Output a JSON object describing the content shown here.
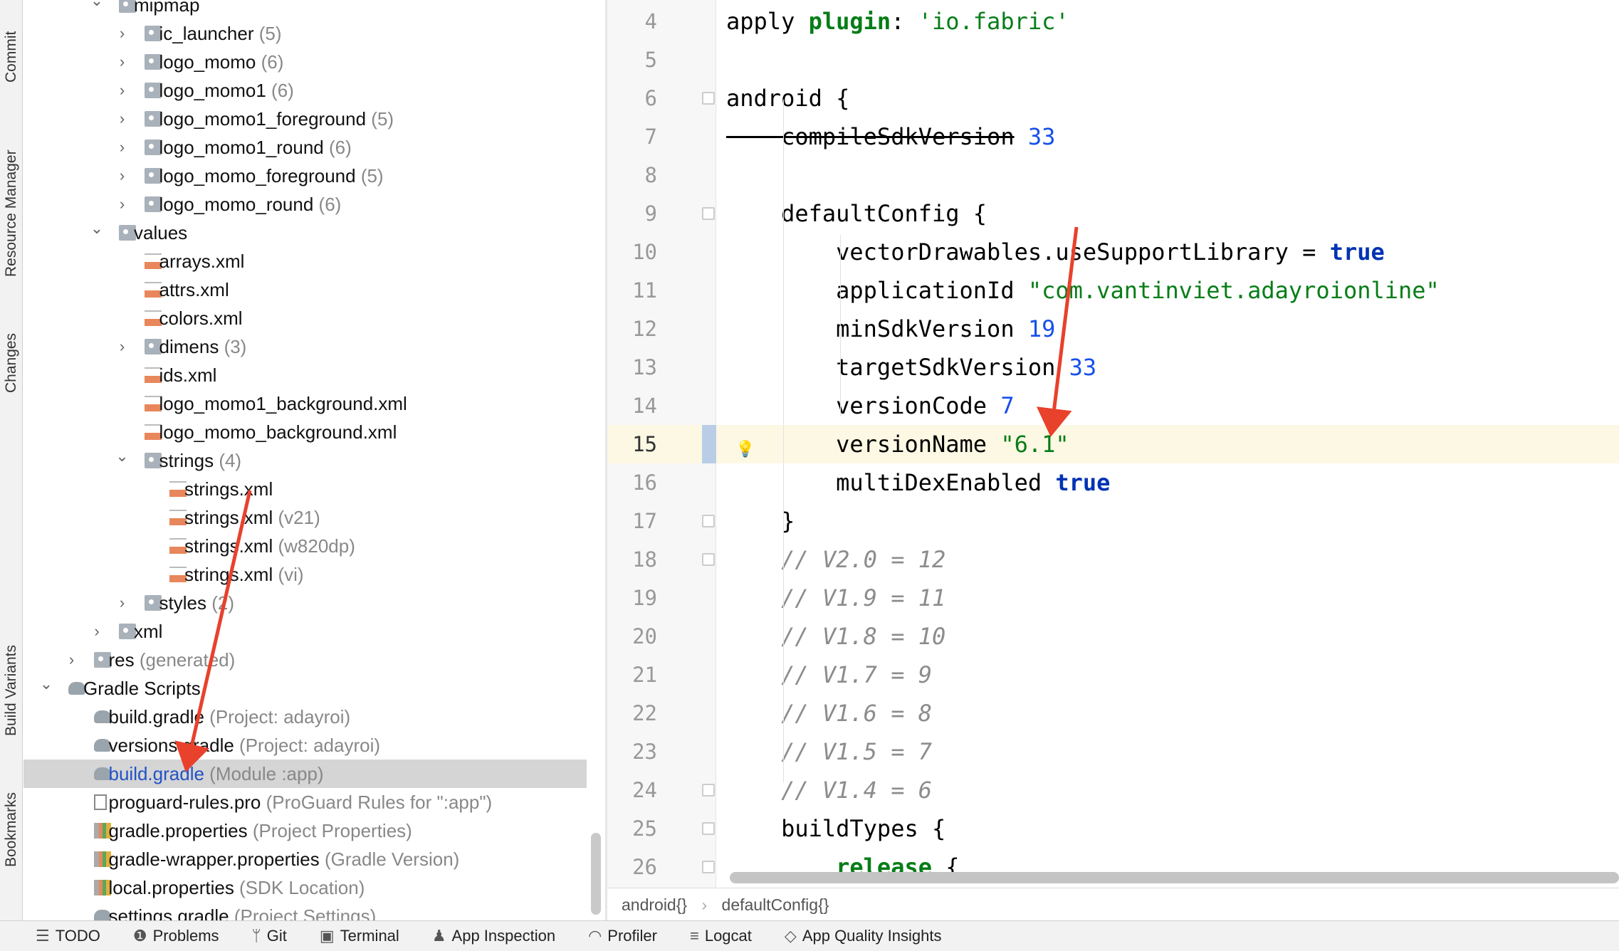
{
  "left_strip": [
    "Commit",
    "Resource Manager",
    "Changes",
    "Build Variants",
    "Bookmarks"
  ],
  "tree": [
    {
      "level": 2,
      "chev": "open",
      "icon": "folder",
      "name": "mipmap",
      "hint": ""
    },
    {
      "level": 3,
      "chev": "closed",
      "icon": "folder",
      "name": "ic_launcher",
      "hint": "(5)"
    },
    {
      "level": 3,
      "chev": "closed",
      "icon": "folder",
      "name": "logo_momo",
      "hint": "(6)"
    },
    {
      "level": 3,
      "chev": "closed",
      "icon": "folder",
      "name": "logo_momo1",
      "hint": "(6)"
    },
    {
      "level": 3,
      "chev": "closed",
      "icon": "folder",
      "name": "logo_momo1_foreground",
      "hint": "(5)"
    },
    {
      "level": 3,
      "chev": "closed",
      "icon": "folder",
      "name": "logo_momo1_round",
      "hint": "(6)"
    },
    {
      "level": 3,
      "chev": "closed",
      "icon": "folder",
      "name": "logo_momo_foreground",
      "hint": "(5)"
    },
    {
      "level": 3,
      "chev": "closed",
      "icon": "folder",
      "name": "logo_momo_round",
      "hint": "(6)"
    },
    {
      "level": 2,
      "chev": "open",
      "icon": "folder",
      "name": "values",
      "hint": ""
    },
    {
      "level": 3,
      "chev": "",
      "icon": "xml",
      "name": "arrays.xml",
      "hint": ""
    },
    {
      "level": 3,
      "chev": "",
      "icon": "xml",
      "name": "attrs.xml",
      "hint": ""
    },
    {
      "level": 3,
      "chev": "",
      "icon": "xml",
      "name": "colors.xml",
      "hint": ""
    },
    {
      "level": 3,
      "chev": "closed",
      "icon": "folder",
      "name": "dimens",
      "hint": "(3)"
    },
    {
      "level": 3,
      "chev": "",
      "icon": "xml",
      "name": "ids.xml",
      "hint": ""
    },
    {
      "level": 3,
      "chev": "",
      "icon": "xml",
      "name": "logo_momo1_background.xml",
      "hint": ""
    },
    {
      "level": 3,
      "chev": "",
      "icon": "xml",
      "name": "logo_momo_background.xml",
      "hint": ""
    },
    {
      "level": 3,
      "chev": "open",
      "icon": "folder",
      "name": "strings",
      "hint": "(4)"
    },
    {
      "level": 4,
      "chev": "",
      "icon": "xml",
      "name": "strings.xml",
      "hint": ""
    },
    {
      "level": 4,
      "chev": "",
      "icon": "xml",
      "name": "strings.xml",
      "hint": "(v21)"
    },
    {
      "level": 4,
      "chev": "",
      "icon": "xml",
      "name": "strings.xml",
      "hint": "(w820dp)"
    },
    {
      "level": 4,
      "chev": "",
      "icon": "xml",
      "name": "strings.xml",
      "hint": "(vi)"
    },
    {
      "level": 3,
      "chev": "closed",
      "icon": "folder",
      "name": "styles",
      "hint": "(2)"
    },
    {
      "level": 2,
      "chev": "closed",
      "icon": "folder",
      "name": "xml",
      "hint": ""
    },
    {
      "level": 1,
      "chev": "closed",
      "icon": "folder",
      "name": "res",
      "hint": "(generated)"
    },
    {
      "level": 0,
      "chev": "open",
      "icon": "gradle",
      "name": "Gradle Scripts",
      "hint": ""
    },
    {
      "level": 1,
      "chev": "",
      "icon": "gradle",
      "name": "build.gradle",
      "hint": "(Project: adayroi)"
    },
    {
      "level": 1,
      "chev": "",
      "icon": "gradle",
      "name": "versions.gradle",
      "hint": "(Project: adayroi)"
    },
    {
      "level": 1,
      "chev": "",
      "icon": "gradle",
      "name": "build.gradle",
      "hint": "(Module :app)",
      "selected": true
    },
    {
      "level": 1,
      "chev": "",
      "icon": "file",
      "name": "proguard-rules.pro",
      "hint": "(ProGuard Rules for \":app\")"
    },
    {
      "level": 1,
      "chev": "",
      "icon": "props",
      "name": "gradle.properties",
      "hint": "(Project Properties)"
    },
    {
      "level": 1,
      "chev": "",
      "icon": "props",
      "name": "gradle-wrapper.properties",
      "hint": "(Gradle Version)"
    },
    {
      "level": 1,
      "chev": "",
      "icon": "props",
      "name": "local.properties",
      "hint": "(SDK Location)"
    },
    {
      "level": 1,
      "chev": "",
      "icon": "gradle",
      "name": "settings.gradle",
      "hint": "(Project Settings)"
    }
  ],
  "code": [
    {
      "n": "4",
      "t": [
        [
          "k",
          "apply "
        ],
        [
          "g",
          "plugin"
        ],
        [
          "k",
          ": "
        ],
        [
          "s",
          "'io.fabric'"
        ]
      ]
    },
    {
      "n": "5",
      "t": []
    },
    {
      "n": "6",
      "fold": true,
      "t": [
        [
          "k",
          "android {"
        ]
      ]
    },
    {
      "n": "7",
      "t": [
        [
          "k st",
          "    compileSdkVersion"
        ],
        [
          "k",
          " "
        ],
        [
          "n",
          "33"
        ]
      ]
    },
    {
      "n": "8",
      "t": []
    },
    {
      "n": "9",
      "fold": true,
      "t": [
        [
          "k",
          "    defaultConfig {"
        ]
      ]
    },
    {
      "n": "10",
      "t": [
        [
          "k",
          "        vectorDrawables.useSupportLibrary = "
        ],
        [
          "b",
          "true"
        ]
      ]
    },
    {
      "n": "11",
      "t": [
        [
          "k",
          "        applicationId "
        ],
        [
          "s",
          "\"com.vantinviet.adayroionline\""
        ]
      ]
    },
    {
      "n": "12",
      "t": [
        [
          "k",
          "        minSdkVersion "
        ],
        [
          "n",
          "19"
        ]
      ]
    },
    {
      "n": "13",
      "t": [
        [
          "k",
          "        targetSdkVersion "
        ],
        [
          "n",
          "33"
        ]
      ]
    },
    {
      "n": "14",
      "t": [
        [
          "k",
          "        versionCode "
        ],
        [
          "n",
          "7"
        ]
      ]
    },
    {
      "n": "15",
      "hl": true,
      "t": [
        [
          "k",
          "        versionName "
        ],
        [
          "s",
          "\"6.1\""
        ]
      ]
    },
    {
      "n": "16",
      "t": [
        [
          "k",
          "        multiDexEnabled "
        ],
        [
          "b",
          "true"
        ]
      ]
    },
    {
      "n": "17",
      "fold": true,
      "t": [
        [
          "k",
          "    }"
        ]
      ]
    },
    {
      "n": "18",
      "fold": true,
      "t": [
        [
          "c",
          "    // V2.0 = 12"
        ]
      ]
    },
    {
      "n": "19",
      "t": [
        [
          "c",
          "    // V1.9 = 11"
        ]
      ]
    },
    {
      "n": "20",
      "t": [
        [
          "c",
          "    // V1.8 = 10"
        ]
      ]
    },
    {
      "n": "21",
      "t": [
        [
          "c",
          "    // V1.7 = 9"
        ]
      ]
    },
    {
      "n": "22",
      "t": [
        [
          "c",
          "    // V1.6 = 8"
        ]
      ]
    },
    {
      "n": "23",
      "t": [
        [
          "c",
          "    // V1.5 = 7"
        ]
      ]
    },
    {
      "n": "24",
      "fold": true,
      "t": [
        [
          "c",
          "    // V1.4 = 6"
        ]
      ]
    },
    {
      "n": "25",
      "fold": true,
      "t": [
        [
          "k",
          "    buildTypes {"
        ]
      ]
    },
    {
      "n": "26",
      "fold": true,
      "t": [
        [
          "g",
          "        release"
        ],
        [
          "k",
          " {"
        ]
      ]
    }
  ],
  "breadcrumb": [
    "android{}",
    "defaultConfig{}"
  ],
  "status_bar": [
    {
      "icon": "list-icon",
      "glyph": "☰",
      "label": "TODO"
    },
    {
      "icon": "problems-icon",
      "glyph": "❶",
      "label": "Problems"
    },
    {
      "icon": "git-branch-icon",
      "glyph": "ᛘ",
      "label": "Git"
    },
    {
      "icon": "terminal-icon",
      "glyph": "▣",
      "label": "Terminal"
    },
    {
      "icon": "app-inspection-icon",
      "glyph": "♟",
      "label": "App Inspection"
    },
    {
      "icon": "profiler-icon",
      "glyph": "◠",
      "label": "Profiler"
    },
    {
      "icon": "logcat-icon",
      "glyph": "≡",
      "label": "Logcat"
    },
    {
      "icon": "diamond-icon",
      "glyph": "◇",
      "label": "App Quality Insights"
    }
  ],
  "colors": {
    "annotation_arrow": "#e8412c",
    "selection": "#d5d5d5",
    "highlight_line": "#fcf8e3"
  }
}
